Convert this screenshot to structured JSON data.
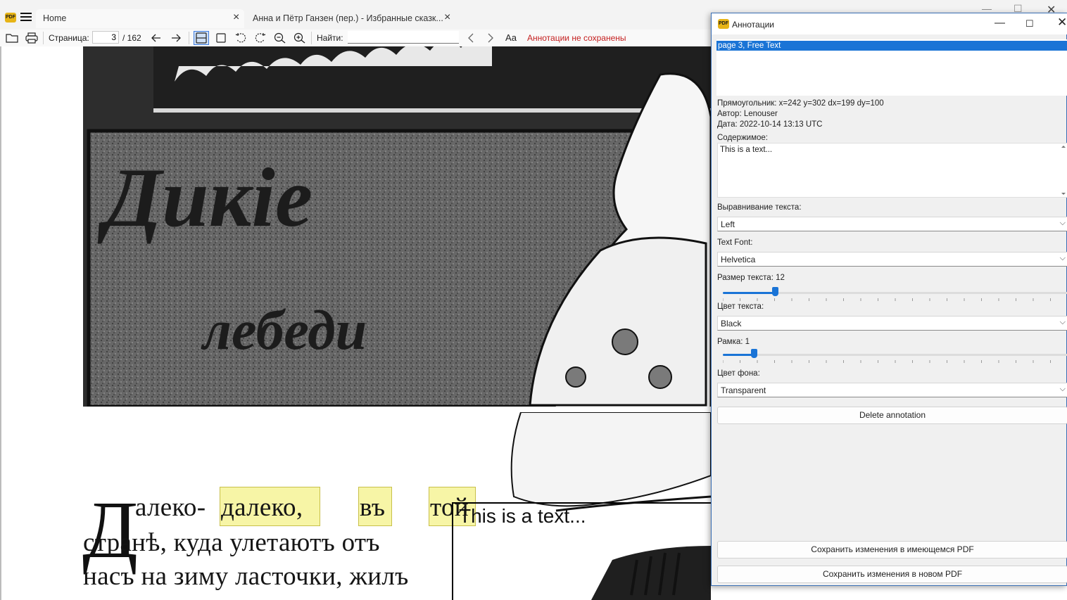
{
  "main_window": {
    "tabs": [
      {
        "label": "Home"
      },
      {
        "label": "Анна и Пётр Ганзен (пер.) - Избранные сказк..."
      }
    ]
  },
  "toolbar": {
    "page_label": "Страница:",
    "page_value": "3",
    "page_total": "/ 162",
    "find_label": "Найти:",
    "find_value": "",
    "unsaved_status": "Аннотации не сохранены",
    "icons": [
      "open-folder-icon",
      "print-icon",
      "arrow-left-icon",
      "arrow-right-icon",
      "fit-width-icon",
      "fit-page-icon",
      "rotate-left-icon",
      "rotate-right-icon",
      "zoom-out-icon",
      "zoom-in-icon",
      "chevron-left-icon",
      "chevron-right-icon",
      "match-case-icon"
    ]
  },
  "document": {
    "illustration_title_line1": "Дикіе",
    "illustration_title_line2": "лебеди",
    "drop_cap": "Д",
    "line1_prefix": "алеко-",
    "highlight1": "далеко,",
    "highlight2": "въ",
    "highlight3": "той",
    "line2": "странѣ,  куда  улетаютъ  отъ",
    "line3": "насъ на зиму ласточки, жилъ",
    "annotation_text": "This is a text..."
  },
  "annotations_window": {
    "title": "Аннотации",
    "list_items": [
      "page 3, Free Text"
    ],
    "rect_info": "Прямоугольник: x=242 y=302 dx=199 dy=100",
    "author_info": "Автор: Lenouser",
    "date_info": "Дата: 2022-10-14 13:13 UTC",
    "content_label": "Содержимое:",
    "content_value": "This is a text...",
    "align_label": "Выравнивание текста:",
    "align_value": "Left",
    "font_label": "Text Font:",
    "font_value": "Helvetica",
    "size_label": "Размер текста: 12",
    "size_slider_fraction": 0.15,
    "color_label": "Цвет текста:",
    "color_value": "Black",
    "border_label": "Рамка: 1",
    "border_slider_fraction": 0.09,
    "bg_label": "Цвет фона:",
    "bg_value": "Transparent",
    "delete_button": "Delete annotation",
    "save_existing_button": "Сохранить изменения в имеющемся PDF",
    "save_new_button": "Сохранить изменения в новом PDF"
  },
  "colors": {
    "accent": "#1a74d6",
    "unsaved": "#c41f1f",
    "highlight": "#f7f5a6",
    "logo": "#e7b416"
  }
}
